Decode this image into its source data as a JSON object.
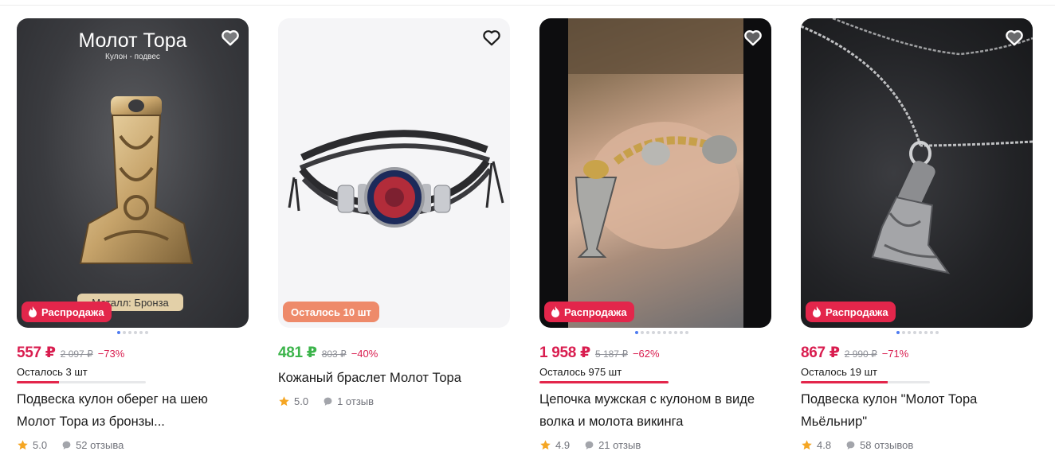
{
  "products": [
    {
      "image_caption": "Молот Тора",
      "image_subcaption": "Кулон - подвес",
      "image_metal_tag": "Металл: Бронза",
      "badge": "Распродажа",
      "price": "557 ₽",
      "old_price": "2 097 ₽",
      "discount": "−73%",
      "stock": "Осталось 3 шт",
      "stock_fraction": 0.33,
      "title_line1": "Подвеска кулон оберег на шею",
      "title_line2": "Молот Тора из бронзы...",
      "rating": "5.0",
      "reviews": "52 отзыва"
    },
    {
      "badge": "Осталось 10 шт",
      "price": "481 ₽",
      "old_price": "803 ₽",
      "discount": "−40%",
      "title_line1": "Кожаный браслет Молот Тора",
      "rating": "5.0",
      "reviews": "1 отзыв"
    },
    {
      "badge": "Распродажа",
      "price": "1 958 ₽",
      "old_price": "5 187 ₽",
      "discount": "−62%",
      "stock": "Осталось 975 шт",
      "stock_fraction": 1.0,
      "title_line1": "Цепочка мужская с кулоном в виде",
      "title_line2": "волка и молота викинга",
      "rating": "4.9",
      "reviews": "21 отзыв"
    },
    {
      "badge": "Распродажа",
      "price": "867 ₽",
      "old_price": "2 990 ₽",
      "discount": "−71%",
      "stock": "Осталось 19 шт",
      "stock_fraction": 0.67,
      "title_line1": "Подвеска кулон \"Молот Тора",
      "title_line2": "Мьёльнир\"",
      "rating": "4.8",
      "reviews": "58 отзывов"
    }
  ],
  "colors": {
    "sale": "#e3264b",
    "price": "#d91d4f",
    "price_green": "#3cb44b",
    "stock_badge": "#ee8a6a",
    "star": "#f5a623"
  },
  "icons": [
    "heart-icon",
    "fire-icon",
    "star-icon",
    "comment-icon"
  ]
}
